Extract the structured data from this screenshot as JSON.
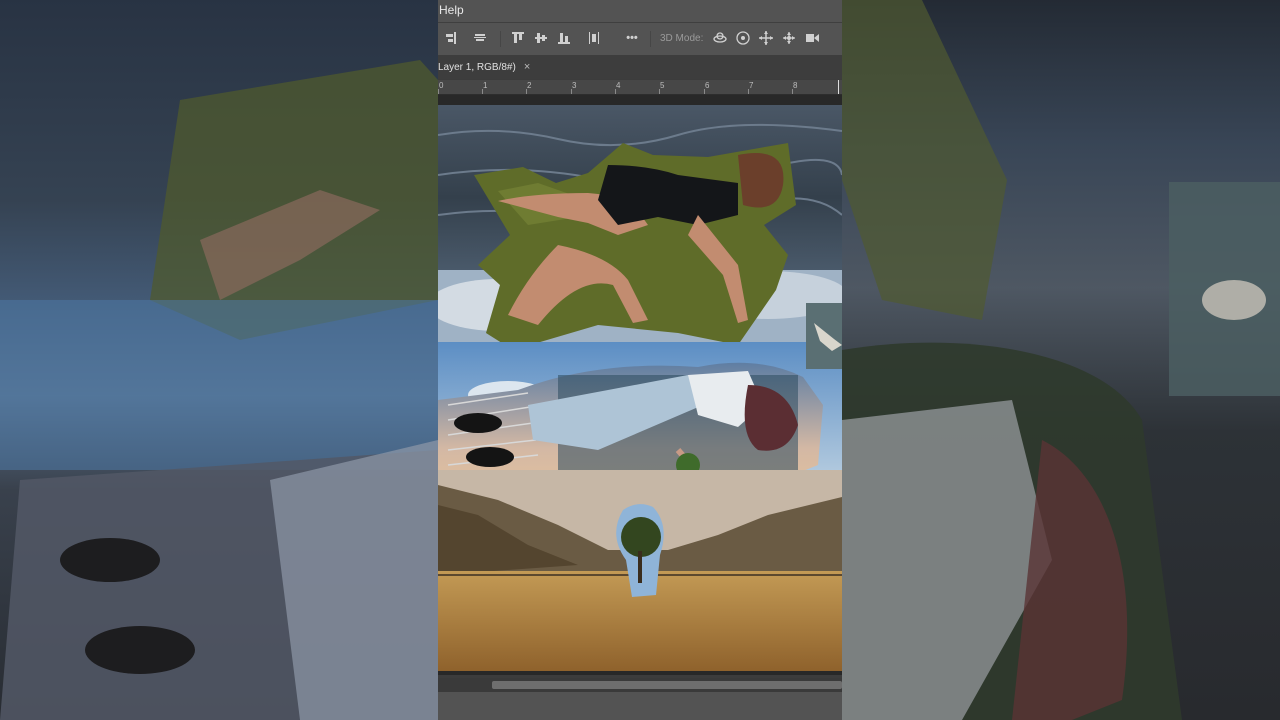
{
  "menu": {
    "help_label": "Help"
  },
  "options_bar": {
    "align_tools": [
      "align-right-icon",
      "align-center-horizontal-icon",
      "align-top-icon",
      "align-middle-vertical-icon",
      "align-bottom-icon",
      "distribute-icon"
    ],
    "more_label": "•••",
    "mode_label": "3D Mode:",
    "mode_tools": [
      "orbit-3d-icon",
      "roll-3d-icon",
      "pan-3d-icon",
      "slide-3d-icon",
      "scale-3d-icon"
    ]
  },
  "document_tab": {
    "title": "Layer 1, RGB/8#)",
    "close_label": "×"
  },
  "ruler": {
    "labels": [
      "0",
      "1",
      "2",
      "3",
      "4",
      "5",
      "6",
      "7",
      "8"
    ]
  },
  "colors": {
    "panel": "#535353",
    "canvas_bg": "#282828",
    "field": "#b98a45",
    "sky": "#6aa0d0",
    "water": "#3e4b59"
  }
}
